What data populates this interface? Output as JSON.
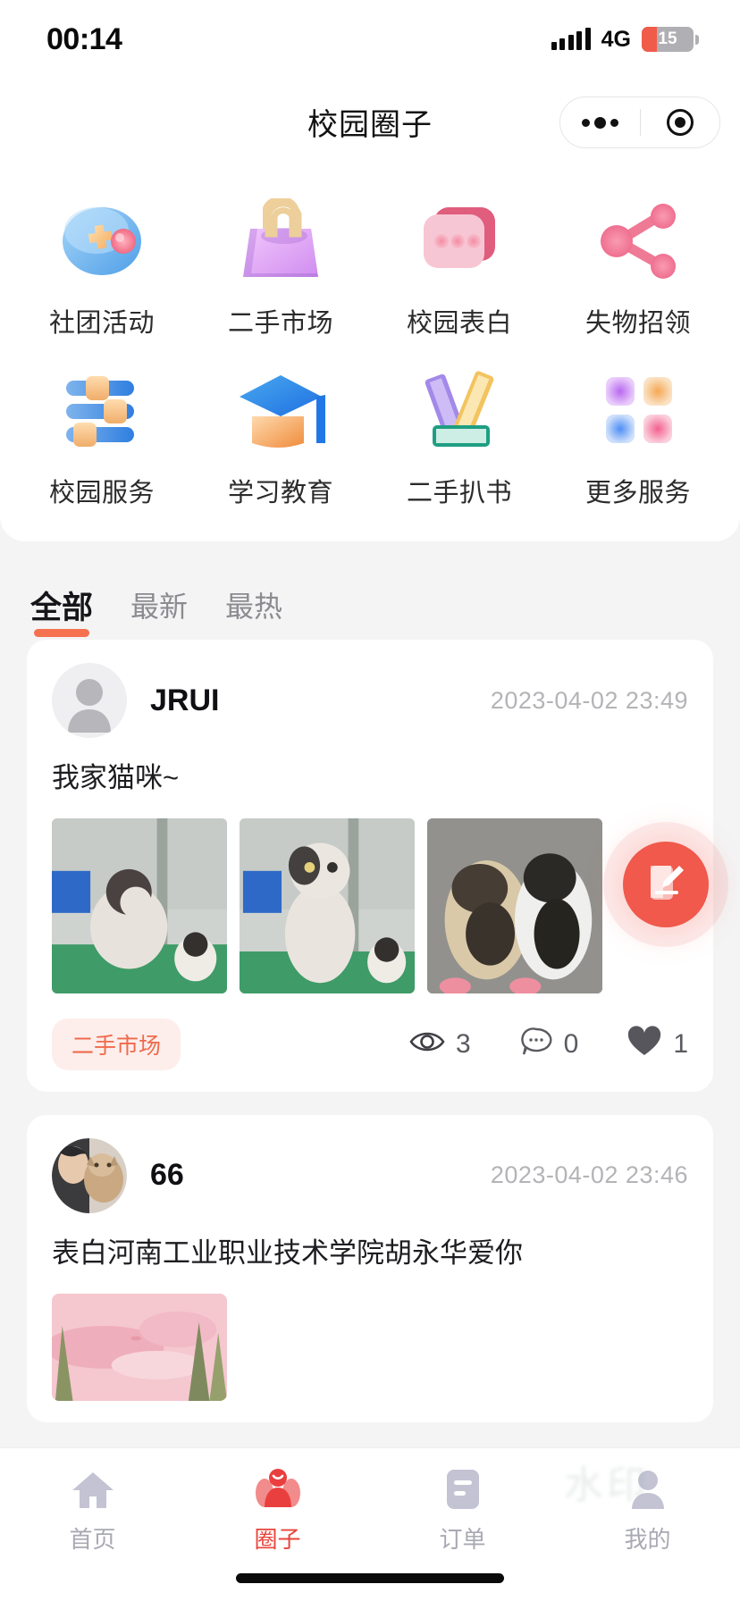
{
  "status_bar": {
    "time": "00:14",
    "network": "4G",
    "battery_level": "15",
    "signal_icon": "signal-bars-icon",
    "battery_icon": "battery-icon"
  },
  "nav": {
    "title": "校园圈子",
    "capsule": {
      "menu_icon": "more-dots-icon",
      "close_icon": "target-circle-icon"
    }
  },
  "grid": {
    "items": [
      {
        "label": "社团活动",
        "icon": "gamepad-icon"
      },
      {
        "label": "二手市场",
        "icon": "handbag-icon"
      },
      {
        "label": "校园表白",
        "icon": "chat-bubble-icon"
      },
      {
        "label": "失物招领",
        "icon": "share-nodes-icon"
      },
      {
        "label": "校园服务",
        "icon": "sliders-icon"
      },
      {
        "label": "学习教育",
        "icon": "graduation-cap-icon"
      },
      {
        "label": "二手扒书",
        "icon": "books-icon"
      },
      {
        "label": "更多服务",
        "icon": "grid-apps-icon"
      }
    ]
  },
  "tabs": [
    {
      "label": "全部",
      "active": true
    },
    {
      "label": "最新",
      "active": false
    },
    {
      "label": "最热",
      "active": false
    }
  ],
  "feed": {
    "posts": [
      {
        "user": "JRUI",
        "time": "2023-04-02 23:49",
        "text": "我家猫咪~",
        "tag": "二手市场",
        "views": "3",
        "comments": "0",
        "likes": "1",
        "avatar_icon": "default-avatar-icon",
        "view_icon": "eye-icon",
        "comment_icon": "comment-icon",
        "like_icon": "heart-icon",
        "images": [
          "cat-photo-1",
          "cat-photo-2",
          "cat-photo-3"
        ]
      },
      {
        "user": "66",
        "time": "2023-04-02 23:46",
        "text": "表白河南工业职业技术学院胡永华爱你",
        "avatar_icon": "user-photo-avatar",
        "images": [
          "pink-landscape-illustration"
        ]
      }
    ]
  },
  "fab": {
    "icon": "compose-edit-icon",
    "color": "#f0594b"
  },
  "bottom_nav": {
    "items": [
      {
        "label": "首页",
        "icon": "home-icon",
        "active": false
      },
      {
        "label": "圈子",
        "icon": "people-circle-icon",
        "active": true
      },
      {
        "label": "订单",
        "icon": "order-list-icon",
        "active": false
      },
      {
        "label": "我的",
        "icon": "person-icon",
        "active": false
      }
    ]
  },
  "colors": {
    "accent": "#f5714f",
    "active_tab": "#e8453c",
    "tag_text": "#ef6a4c",
    "tag_bg": "#fdeeeb"
  },
  "watermark": {
    "text": "水印"
  }
}
